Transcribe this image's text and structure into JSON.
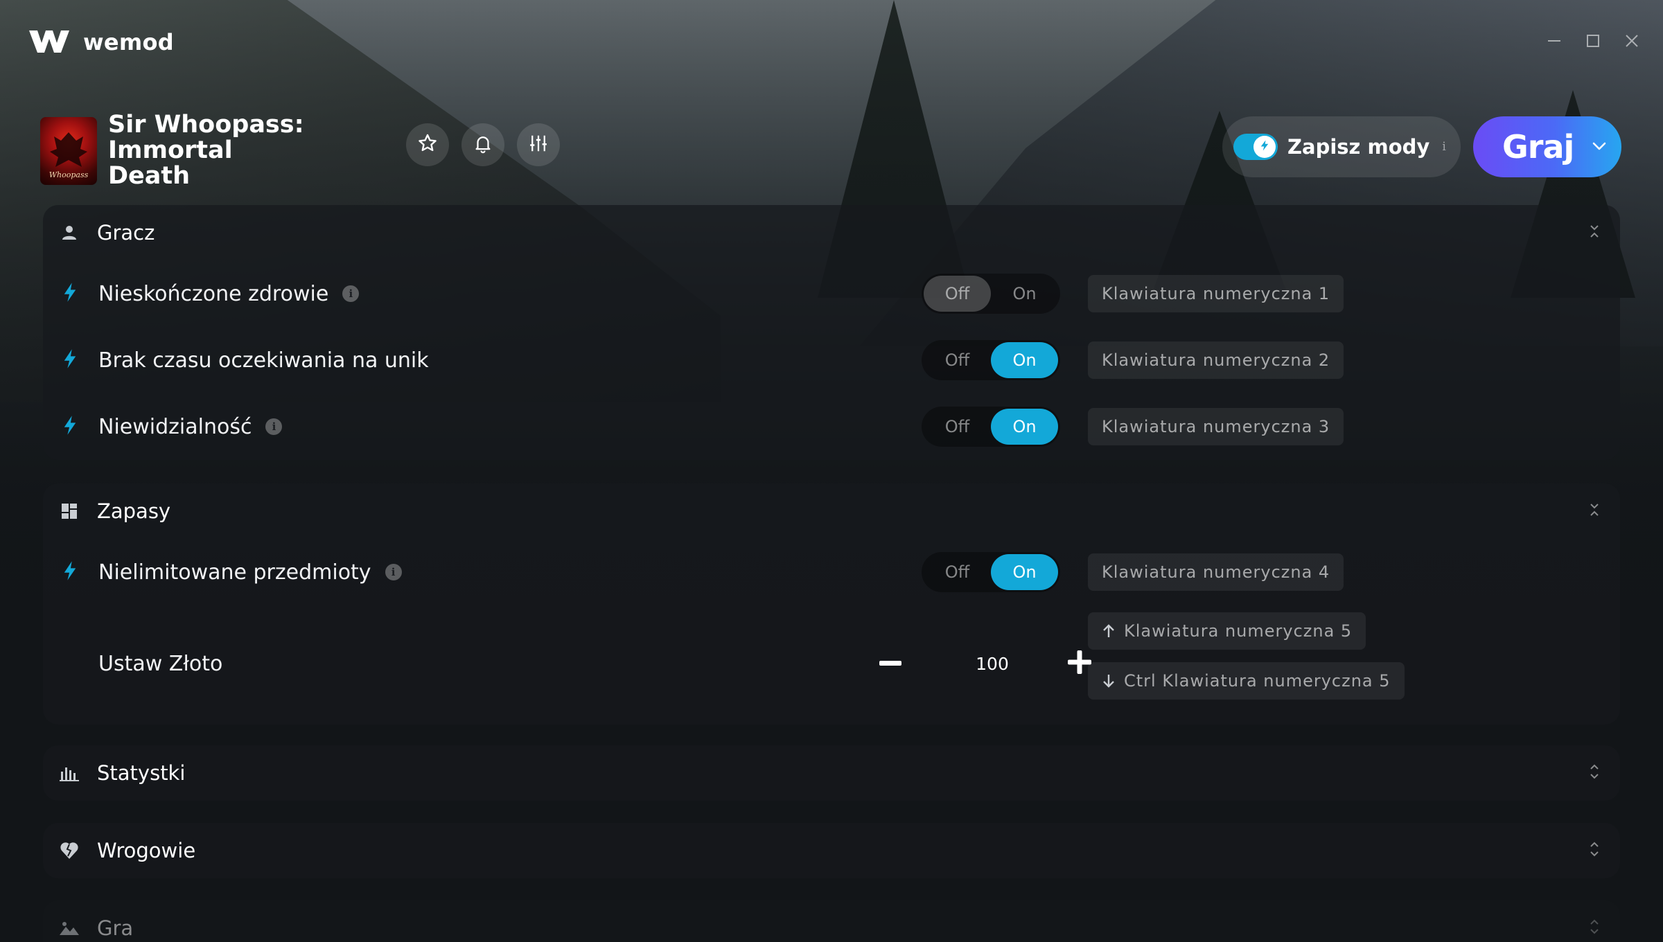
{
  "app": {
    "name": "wemod"
  },
  "game": {
    "title": "Sir Whoopass: Immortal Death",
    "title_line1": "Sir Whoopass:",
    "title_line2": "Immortal Death",
    "thumbnail_text": "Whoopass"
  },
  "header": {
    "save_mods_label": "Zapisz mody",
    "save_mods_enabled": true,
    "save_mods_info": "i",
    "play_label": "Graj"
  },
  "toggle_labels": {
    "off": "Off",
    "on": "On"
  },
  "sections": {
    "player": {
      "title": "Gracz",
      "mods": [
        {
          "label": "Nieskończone zdrowie",
          "state": "off",
          "hotkey": "Klawiatura numeryczna 1",
          "info": true
        },
        {
          "label": "Brak czasu oczekiwania na unik",
          "state": "on",
          "hotkey": "Klawiatura numeryczna 2",
          "info": false
        },
        {
          "label": "Niewidzialność",
          "state": "on",
          "hotkey": "Klawiatura numeryczna 3",
          "info": true
        }
      ]
    },
    "inventory": {
      "title": "Zapasy",
      "mods": [
        {
          "label": "Nielimitowane przedmioty",
          "state": "on",
          "hotkey": "Klawiatura numeryczna 4",
          "info": true
        }
      ],
      "gold": {
        "label": "Ustaw Złoto",
        "value": "100",
        "hotkey_increase": "Klawiatura numeryczna 5",
        "hotkey_decrease": "Ctrl Klawiatura numeryczna 5"
      }
    },
    "stats": {
      "title": "Statystki"
    },
    "enemies": {
      "title": "Wrogowie"
    },
    "game": {
      "title": "Gra"
    }
  },
  "colors": {
    "accent": "#13a8d8",
    "play_gradient_start": "#6a4cf5",
    "play_gradient_end": "#27a6f0",
    "background": "#121518"
  }
}
